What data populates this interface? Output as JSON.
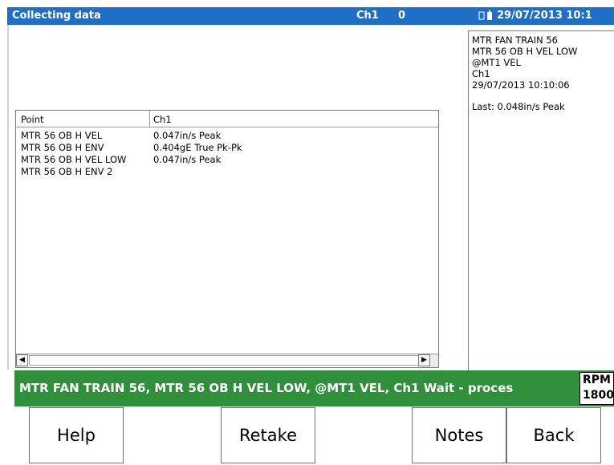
{
  "titlebar": {
    "status": "Collecting data",
    "channel": "Ch1",
    "count": "0",
    "icons": "[]·ĸ",
    "datetime": "29/07/2013 10:1",
    "color": "#1f6fc8"
  },
  "list": {
    "headers": [
      "Point",
      "Ch1"
    ],
    "rows": [
      {
        "point": "MTR 56 OB H VEL",
        "value": "0.047in/s Peak"
      },
      {
        "point": "MTR 56 OB H ENV",
        "value": "0.404gE True Pk-Pk"
      },
      {
        "point": "MTR 56 OB H VEL LOW",
        "value": "0.047in/s Peak"
      },
      {
        "point": "MTR 56 OB H ENV 2",
        "value": ""
      }
    ],
    "scroll_left": "◀",
    "scroll_right": "▶"
  },
  "info": {
    "lines": [
      "MTR FAN TRAIN 56",
      "MTR 56 OB H VEL LOW",
      "@MT1 VEL",
      "Ch1",
      "29/07/2013 10:10:06"
    ],
    "last": "Last: 0.048in/s Peak"
  },
  "status": {
    "text": "MTR FAN TRAIN 56, MTR 56 OB H VEL LOW, @MT1 VEL, Ch1 Wait - proces",
    "color": "#2f8f3a",
    "rpm_label": "RPM",
    "rpm_value": "1800"
  },
  "buttons": {
    "help": "Help",
    "retake": "Retake",
    "notes": "Notes",
    "back": "Back"
  }
}
